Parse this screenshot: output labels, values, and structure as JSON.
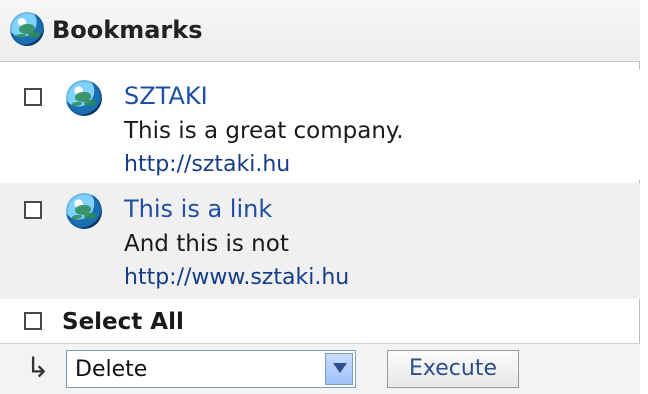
{
  "header": {
    "title": "Bookmarks",
    "icon": "globe-icon"
  },
  "bookmarks": [
    {
      "title": "SZTAKI",
      "description": "This is a great company.",
      "url": "http://sztaki.hu"
    },
    {
      "title": "This is a link",
      "description": "And this is not",
      "url": "http://www.sztaki.hu"
    }
  ],
  "select_all": {
    "label": "Select All"
  },
  "actions": {
    "selected_action": "Delete",
    "execute_label": "Execute",
    "arrow": "↳"
  },
  "colors": {
    "link": "#1f4fa3",
    "url": "#153d87",
    "row_alt_bg": "#f0f0f0"
  }
}
